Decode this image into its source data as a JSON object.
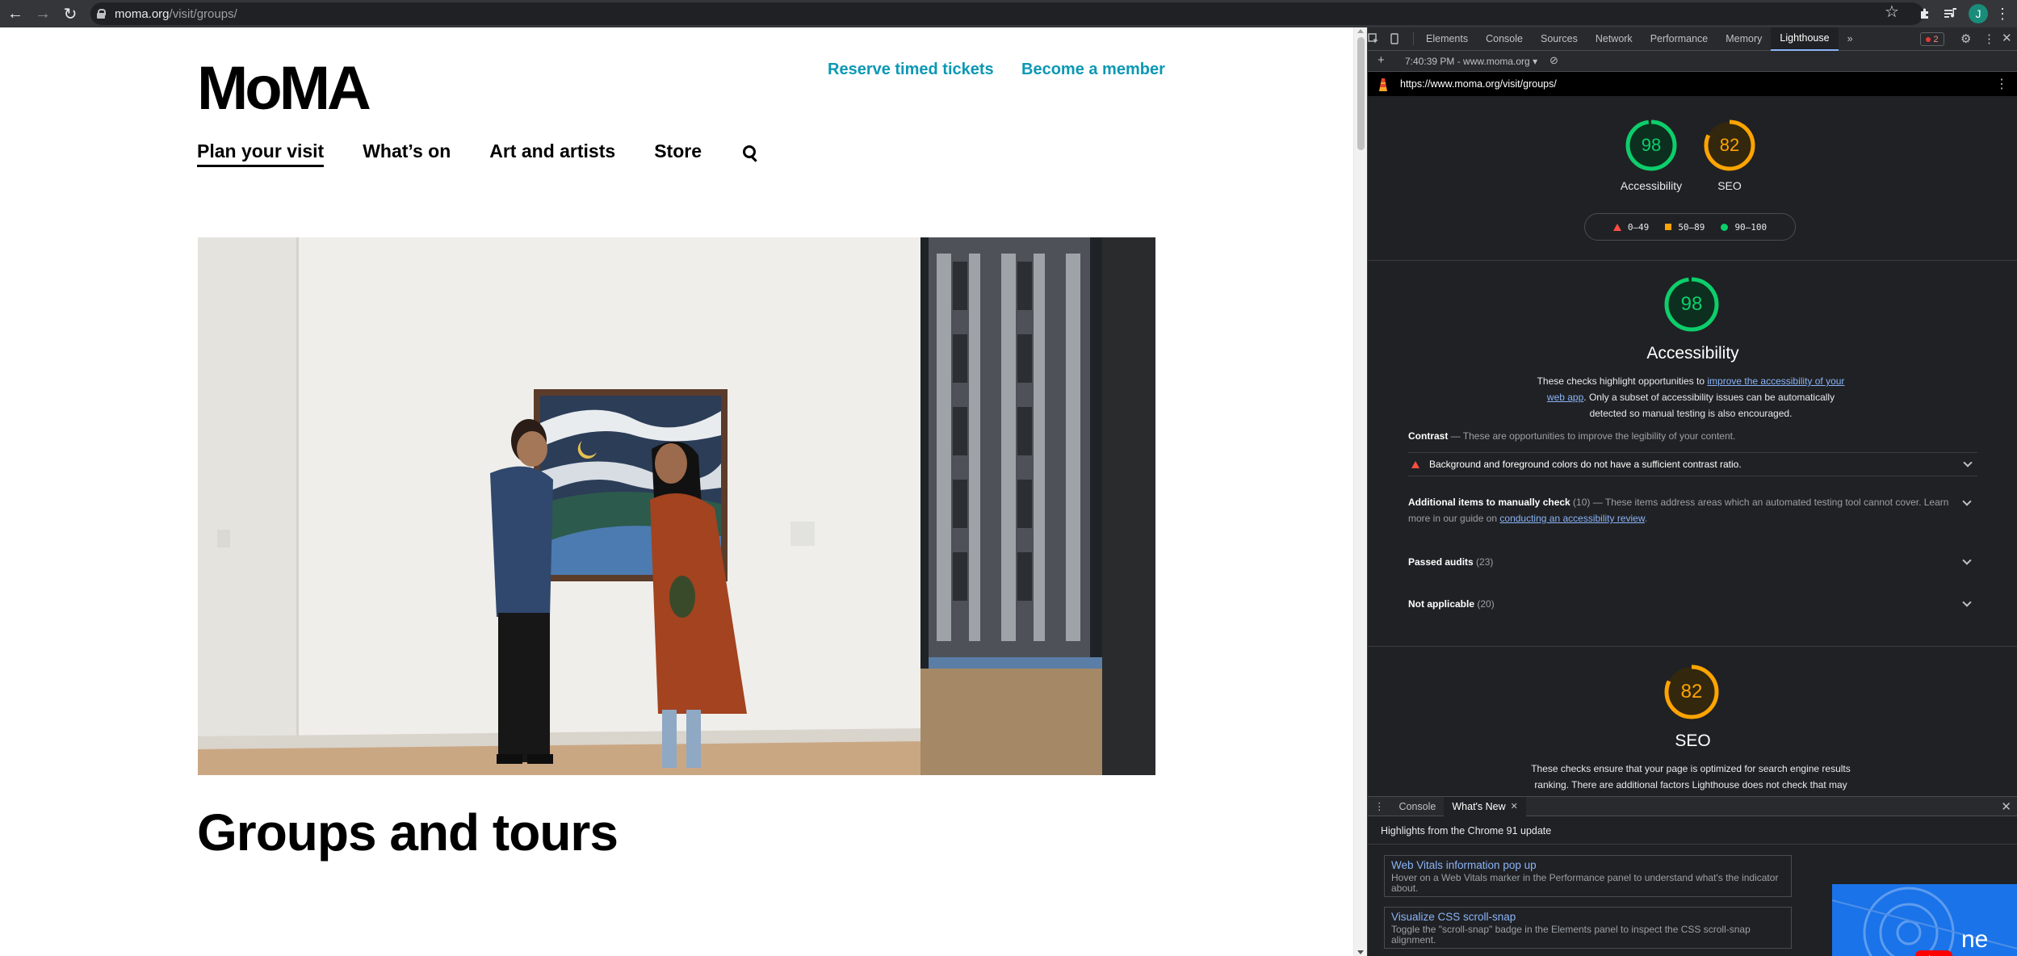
{
  "browser": {
    "url_host": "moma.org",
    "url_path": "/visit/groups/",
    "avatar_initial": "J"
  },
  "site": {
    "logo": "MoMA",
    "top_links": [
      "Reserve timed tickets",
      "Become a member"
    ],
    "nav": [
      "Plan your visit",
      "What’s on",
      "Art and artists",
      "Store"
    ],
    "active_nav": "Plan your visit",
    "page_title": "Groups and tours",
    "accent_color": "#0b98b4"
  },
  "devtools": {
    "tabs": [
      "Elements",
      "Console",
      "Sources",
      "Network",
      "Performance",
      "Memory",
      "Lighthouse"
    ],
    "active_tab": "Lighthouse",
    "more_tabs": "»",
    "issue_count": "2",
    "report_time": "7:40:39 PM - www.moma.org",
    "report_url": "https://www.moma.org/visit/groups/",
    "scores": [
      {
        "label": "Accessibility",
        "value": 98,
        "color": "#0cce6b"
      },
      {
        "label": "SEO",
        "value": 82,
        "color": "#ffa400"
      }
    ],
    "legend": [
      {
        "range": "0–49",
        "shape": "triangle",
        "color": "#ff4e42"
      },
      {
        "range": "50–89",
        "shape": "square",
        "color": "#ffa400"
      },
      {
        "range": "90–100",
        "shape": "circle",
        "color": "#0cce6b"
      }
    ],
    "accessibility": {
      "score": "98",
      "title": "Accessibility",
      "desc_before": "These checks highlight opportunities to ",
      "desc_link": "improve the accessibility of your web app",
      "desc_after": ". Only a subset of accessibility issues can be automatically detected so manual testing is also encouraged.",
      "contrast_title": "Contrast",
      "contrast_desc": " — These are opportunities to improve the legibility of your content.",
      "contrast_audit": "Background and foreground colors do not have a sufficient contrast ratio.",
      "manual_title": "Additional items to manually check",
      "manual_count": " (10)",
      "manual_desc": " — These items address areas which an automated testing tool cannot cover. Learn more in our guide on ",
      "manual_link": "conducting an accessibility review",
      "manual_end": ".",
      "passed_title": "Passed audits",
      "passed_count": " (23)",
      "na_title": "Not applicable",
      "na_count": " (20)"
    },
    "seo": {
      "score": "82",
      "title": "SEO",
      "desc": "These checks ensure that your page is optimized for search engine results ranking. There are additional factors Lighthouse does not check that may"
    },
    "drawer": {
      "tabs": [
        "Console",
        "What's New"
      ],
      "active_tab": "What's New",
      "highlights": "Highlights from the Chrome 91 update",
      "cards": [
        {
          "title": "Web Vitals information pop up",
          "desc": "Hover on a Web Vitals marker in the Performance panel to understand what's the indicator about."
        },
        {
          "title": "Visualize CSS scroll-snap",
          "desc": "Toggle the \"scroll-snap\" badge in the Elements panel to inspect the CSS scroll-snap alignment."
        }
      ],
      "video_text": "ne"
    }
  }
}
